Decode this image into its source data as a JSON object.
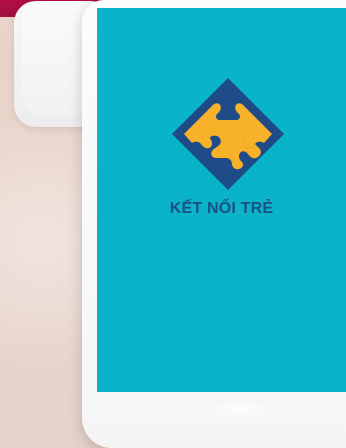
{
  "brand": {
    "name": "KẾT NỐI TRẺ"
  },
  "logo": {
    "icon_name": "puzzle-diamond-icon"
  },
  "colors": {
    "screen_background": "#09b3c8",
    "brand_text": "#1c4e87",
    "logo_orange": "#f7b22a",
    "logo_navy": "#1f4c89"
  }
}
